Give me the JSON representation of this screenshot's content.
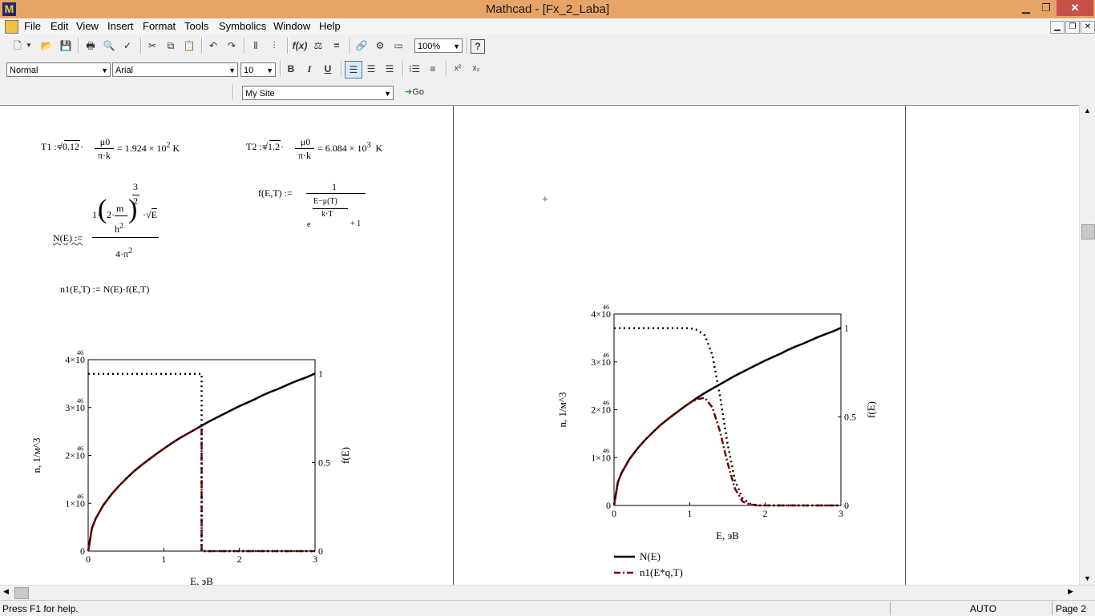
{
  "window": {
    "title": "Mathcad - [Fx_2_Laba]",
    "app_icon": "M"
  },
  "menu": [
    "File",
    "Edit",
    "View",
    "Insert",
    "Format",
    "Tools",
    "Symbolics",
    "Window",
    "Help"
  ],
  "toolbar2": {
    "style": "Normal",
    "font": "Arial",
    "size": "10",
    "bold": "B",
    "italic": "I",
    "underline": "U"
  },
  "toolbar1": {
    "zoom": "100%"
  },
  "toolbar3": {
    "site": "My Site",
    "go": "Go"
  },
  "math": {
    "t1": {
      "lhs": "T1 :=",
      "rad": "0.12",
      "mid": "·",
      "num": "μ0",
      "den": "π·k",
      "res_pre": "= 1.924 × 10",
      "exp": "2",
      "unit": "K"
    },
    "t2": {
      "lhs": "T2 :=",
      "rad": "1.2",
      "mid": "·",
      "num": "μ0",
      "den": "π·k",
      "res_pre": "= 6.084 × 10",
      "exp": "3",
      "unit": "K"
    },
    "fe": {
      "lhs": "f(E,T) :=",
      "num": "1",
      "e": "e",
      "exp_num": "E−μ(T)",
      "exp_den": "k·T",
      "plus": "+ 1"
    },
    "ne": {
      "lhs": "N(E) :=",
      "pre": "1·",
      "two": "2·",
      "m": "m",
      "h": "h",
      "h_exp": "2",
      "outer_num": "3",
      "outer_den": "2",
      "sqrt": "E",
      "den": "4·π",
      "den_exp": "2"
    },
    "n1": {
      "text": "n1(E,T) := N(E)·f(E,T)"
    },
    "cursor": "+"
  },
  "chart_data": [
    {
      "type": "line",
      "x": [
        0,
        0.05,
        0.1,
        0.2,
        0.3,
        0.4,
        0.5,
        0.6,
        0.7,
        0.8,
        0.9,
        1.0,
        1.1,
        1.2,
        1.3,
        1.4,
        1.5,
        1.6,
        1.7,
        1.8,
        1.9,
        2.0,
        2.1,
        2.2,
        2.3,
        2.4,
        2.5,
        2.6,
        2.7,
        2.8,
        2.9,
        3.0
      ],
      "series": [
        {
          "name": "N(E)",
          "axis": "left",
          "style": "solid",
          "color": "#000000",
          "values": [
            0,
            0.48,
            0.68,
            0.96,
            1.17,
            1.35,
            1.51,
            1.66,
            1.79,
            1.91,
            2.03,
            2.14,
            2.25,
            2.35,
            2.44,
            2.53,
            2.62,
            2.71,
            2.79,
            2.87,
            2.95,
            3.03,
            3.1,
            3.17,
            3.25,
            3.32,
            3.38,
            3.45,
            3.52,
            3.58,
            3.64,
            3.71
          ]
        },
        {
          "name": "n1(E*q,T)",
          "axis": "left",
          "style": "dashdot",
          "color": "#7a0000",
          "values": [
            0,
            0.48,
            0.68,
            0.96,
            1.17,
            1.35,
            1.51,
            1.66,
            1.79,
            1.91,
            2.03,
            2.14,
            2.25,
            2.35,
            2.44,
            2.53,
            0,
            0,
            0,
            0,
            0,
            0,
            0,
            0,
            0,
            0,
            0,
            0,
            0,
            0,
            0,
            0
          ]
        },
        {
          "name": "f(E)",
          "axis": "right",
          "style": "dotted",
          "color": "#000000",
          "values": [
            1,
            1,
            1,
            1,
            1,
            1,
            1,
            1,
            1,
            1,
            1,
            1,
            1,
            1,
            1,
            1,
            0,
            0,
            0,
            0,
            0,
            0,
            0,
            0,
            0,
            0,
            0,
            0,
            0,
            0,
            0,
            0
          ]
        }
      ],
      "step_at": 1.5,
      "ylabel": "n, 1/м^3",
      "y2label": "f(E)",
      "xlabel": "E, эВ",
      "xlim": [
        0,
        3
      ],
      "ylim": [
        0,
        4e+46
      ],
      "y2lim": [
        0,
        1.08
      ],
      "xticks": [
        "0",
        "1",
        "2",
        "3"
      ],
      "yticks": [
        "0",
        "1×10",
        "2×10",
        "3×10",
        "4×10"
      ],
      "ytick_exp": "46",
      "y2ticks": [
        "0",
        "0.5",
        "1"
      ]
    },
    {
      "type": "line",
      "x": [
        0,
        0.05,
        0.1,
        0.2,
        0.3,
        0.4,
        0.5,
        0.6,
        0.7,
        0.8,
        0.9,
        1.0,
        1.1,
        1.2,
        1.3,
        1.4,
        1.5,
        1.6,
        1.7,
        1.8,
        1.9,
        2.0,
        2.1,
        2.2,
        2.3,
        2.4,
        2.5,
        2.6,
        2.7,
        2.8,
        2.9,
        3.0
      ],
      "series": [
        {
          "name": "N(E)",
          "axis": "left",
          "style": "solid",
          "color": "#000000",
          "values": [
            0,
            0.48,
            0.68,
            0.96,
            1.17,
            1.35,
            1.51,
            1.66,
            1.79,
            1.91,
            2.03,
            2.14,
            2.25,
            2.35,
            2.44,
            2.53,
            2.62,
            2.71,
            2.79,
            2.87,
            2.95,
            3.03,
            3.1,
            3.17,
            3.25,
            3.32,
            3.38,
            3.45,
            3.52,
            3.58,
            3.64,
            3.71
          ]
        },
        {
          "name": "n1(E*q,T)",
          "axis": "left",
          "style": "dashdot",
          "color": "#7a0000",
          "values": [
            0,
            0.48,
            0.68,
            0.96,
            1.17,
            1.35,
            1.51,
            1.66,
            1.79,
            1.91,
            2.03,
            2.14,
            2.22,
            2.25,
            2.05,
            1.55,
            0.9,
            0.35,
            0.08,
            0.02,
            0,
            0,
            0,
            0,
            0,
            0,
            0,
            0,
            0,
            0,
            0,
            0
          ]
        },
        {
          "name": "f(E)",
          "axis": "right",
          "style": "dotted",
          "color": "#000000",
          "values": [
            1,
            1,
            1,
            1,
            1,
            1,
            1,
            1,
            1,
            1,
            1,
            1,
            0.99,
            0.96,
            0.85,
            0.62,
            0.35,
            0.14,
            0.04,
            0.01,
            0,
            0,
            0,
            0,
            0,
            0,
            0,
            0,
            0,
            0,
            0,
            0
          ]
        }
      ],
      "ylabel": "n, 1/м^3",
      "y2label": "f(E)",
      "xlabel": "E, эВ",
      "xlim": [
        0,
        3
      ],
      "ylim": [
        0,
        4e+46
      ],
      "y2lim": [
        0,
        1.08
      ],
      "xticks": [
        "0",
        "1",
        "2",
        "3"
      ],
      "yticks": [
        "0",
        "1×10",
        "2×10",
        "3×10",
        "4×10"
      ],
      "ytick_exp": "46",
      "y2ticks": [
        "0",
        "0.5",
        "1"
      ],
      "legend": [
        "N(E)",
        "n1(E*q,T)"
      ]
    }
  ],
  "status": {
    "help": "Press F1 for help.",
    "mode": "AUTO",
    "page": "Page 2"
  }
}
